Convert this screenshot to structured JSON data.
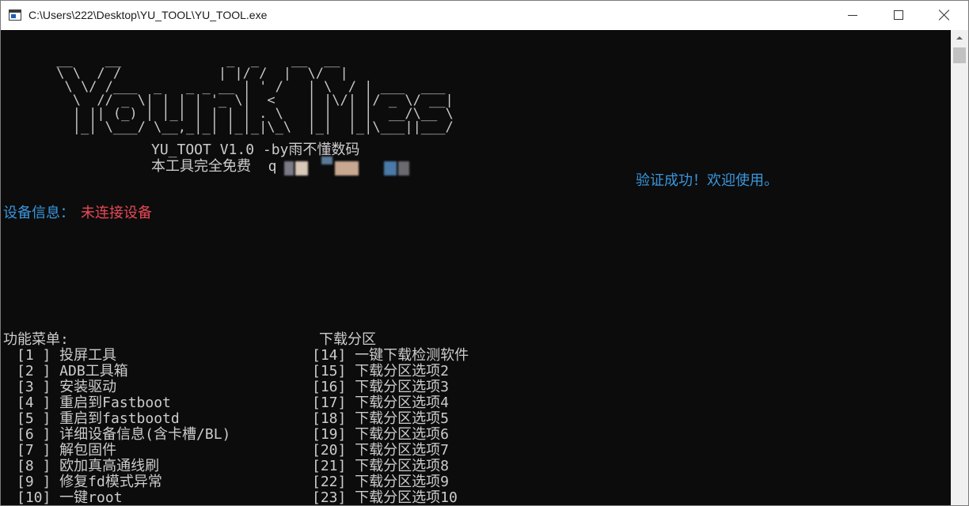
{
  "window": {
    "title": "C:\\Users\\222\\Desktop\\YU_TOOL\\YU_TOOL.exe"
  },
  "banner": {
    "ascii_art": " __    __             _  _    __  __\n \\ \\  / /            | |/ /  |  \\/  |\n  \\ \\/ /___  _   _ _ __ | ' /   | \\  / | ___  ___\n   \\  // _ \\| | | | '_ \\|  <    | |\\/| |/ _ \\/ __|\n   | || (_) | |_| | | | | . \\   | |  | |  __/\\__ \\\n   |_| \\___/ \\__,_|_| |_|_|\\_\\  |_|  |_|\\___||___/",
    "version": "YU_TOOT V1.0 -by雨不懂数码",
    "free_note": "本工具完全免费  q"
  },
  "status": {
    "verify": "验证成功！欢迎使用。",
    "device_label": "设备信息：",
    "device_status": "未连接设备"
  },
  "menu": {
    "title": "功能菜单:",
    "items": [
      "[1 ] 投屏工具",
      "[2 ] ADB工具箱",
      "[3 ] 安装驱动",
      "[4 ] 重启到Fastboot",
      "[5 ] 重启到fastbootd",
      "[6 ] 详细设备信息(含卡槽/BL)",
      "[7 ] 解包固件",
      "[8 ] 欧加真高通线刷",
      "[9 ] 修复fd模式异常",
      "[10] 一键root"
    ]
  },
  "partition": {
    "title": "下载分区",
    "items": [
      "[14] 一键下载检测软件",
      "[15] 下载分区选项2",
      "[16] 下载分区选项3",
      "[17] 下载分区选项4",
      "[18] 下载分区选项5",
      "[19] 下载分区选项6",
      "[20] 下载分区选项7",
      "[21] 下载分区选项8",
      "[22] 下载分区选项9",
      "[23] 下载分区选项10"
    ]
  },
  "colors": {
    "console_bg": "#0c0c0c",
    "console_text": "#cccccc",
    "info_blue": "#3a96dd",
    "error_red": "#e74856"
  }
}
